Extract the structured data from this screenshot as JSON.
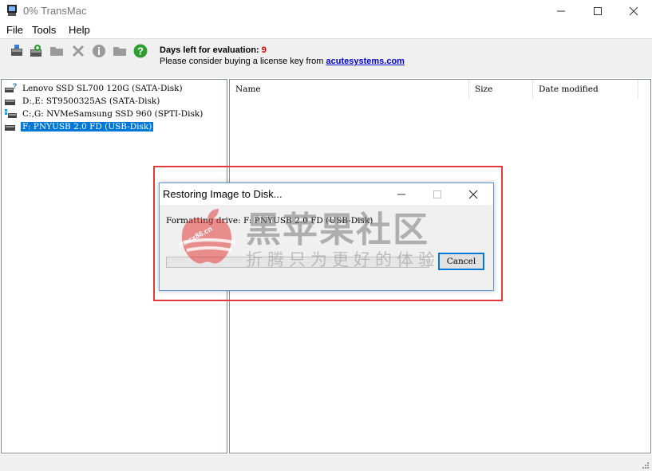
{
  "window": {
    "title": "0% TransMac"
  },
  "menu": [
    "File",
    "Tools",
    "Help"
  ],
  "toolbar": {
    "icons": [
      "open-disk-icon",
      "restore-image-icon",
      "folder-icon",
      "delete-icon",
      "info-icon",
      "new-folder-icon",
      "help-icon"
    ],
    "eval_label": "Days left for evaluation:",
    "eval_days": "9",
    "license_text": "Please consider buying a license key from",
    "license_link": "acutesystems.com"
  },
  "disks": [
    {
      "label": "Lenovo SSD SL700 120G (SATA-Disk)",
      "selected": false
    },
    {
      "label": "D:,E: ST9500325AS (SATA-Disk)",
      "selected": false
    },
    {
      "label": "C:,G: NVMeSamsung SSD 960 (SPTI-Disk)",
      "selected": false
    },
    {
      "label": "F: PNYUSB 2.0 FD (USB-Disk)",
      "selected": true
    }
  ],
  "columns": [
    "Name",
    "Size",
    "Date modified"
  ],
  "dialog": {
    "title": "Restoring Image to Disk...",
    "status": "Formatting drive: F: PNYUSB 2.0 FD (USB-Disk)",
    "progress": 0,
    "cancel_label": "Cancel"
  },
  "watermark": {
    "title": "黑苹果社区",
    "subtitle": "折腾只为更好的体验",
    "url": "macx86.cn"
  },
  "colors": {
    "highlight_box": "#e23a3a",
    "selection": "#0078d7",
    "eval_days": "#d00000",
    "link": "#0000cc"
  }
}
